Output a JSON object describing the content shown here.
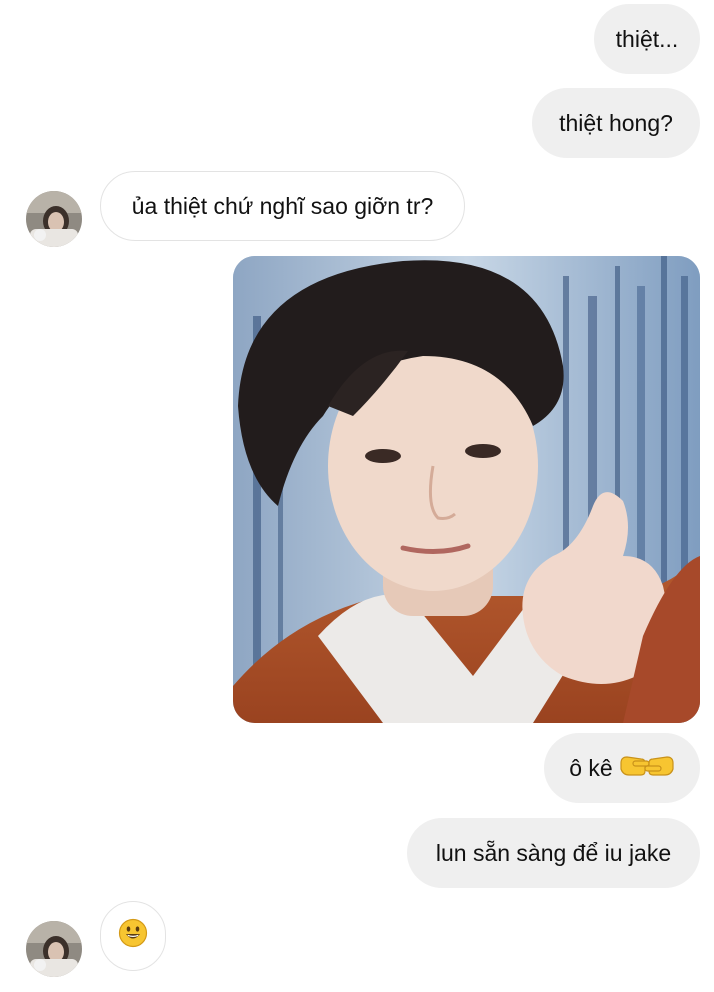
{
  "conversation": {
    "messages": [
      {
        "from": "me",
        "text": "thiệt..."
      },
      {
        "from": "me",
        "text": "thiệt hong?"
      },
      {
        "from": "them",
        "text": "ủa thiệt chứ nghĩ sao giỡn tr?"
      },
      {
        "from": "me",
        "type": "photo"
      },
      {
        "from": "me",
        "text": "ô kê",
        "emoji": "👉👈"
      },
      {
        "from": "me",
        "text": "lun sẵn sàng để iu jake"
      },
      {
        "from": "them",
        "type": "emoji",
        "emoji": "😀"
      }
    ]
  },
  "icons": {
    "avatar": "contact-avatar",
    "emoji_pointing": "pointing-fingers-icon",
    "emoji_smile": "grinning-face-icon"
  },
  "colors": {
    "outgoing_bubble": "#efefef",
    "incoming_bubble_border": "#e3e3e3",
    "text": "#111111",
    "emoji_yellow": "#f7c531"
  }
}
